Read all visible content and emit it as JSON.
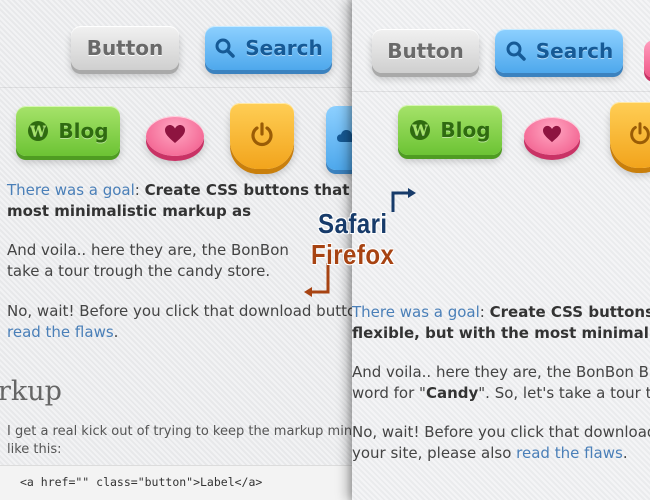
{
  "labels": {
    "safari": "Safari",
    "firefox": "Firefox"
  },
  "colors": {
    "safari_label": "#173b6a",
    "firefox_label": "#a74312",
    "link": "#4a7fb8"
  },
  "firefox_panel": {
    "buttons": {
      "button_label": "Button",
      "search_label": "Search",
      "blog_label": "Blog",
      "heart_icon": "heart-icon",
      "power_icon": "power-icon",
      "search_icon": "search-icon",
      "wordpress_icon": "wordpress-icon"
    },
    "p1": {
      "link": "There was a goal",
      "colon": ": ",
      "bold1": "Create CSS buttons that a",
      "bold2": "most minimalistic markup as"
    },
    "p2": {
      "line1": "And voila.. here they are, the BonBon",
      "line2": "take a tour trough the candy store."
    },
    "p3": {
      "line1": "No, wait! Before you click that download butto",
      "link": "read the flaws",
      "end": "."
    },
    "heading": "rkup",
    "p4": {
      "line1": "I get a real kick out of trying to keep the markup minima",
      "line2": "like this:"
    },
    "code": "<a href=\"\" class=\"button\">Label</a>"
  },
  "safari_panel": {
    "buttons": {
      "button_label": "Button",
      "search_label": "Search",
      "blog_label": "Blog"
    },
    "p1": {
      "link": "There was a goal",
      "colon": ": ",
      "bold1": "Create CSS buttons",
      "bold2": "flexible, but with the most minimali"
    },
    "p2": {
      "line1": "And voila.. here they are, the BonBon Bu",
      "line2a": "word for \"",
      "line2b": "Candy",
      "line2c": "\". So, let's take a tour tr"
    },
    "p3": {
      "line1": "No, wait! Before you click that download",
      "line2a": "your site, please also ",
      "link": "read the flaws",
      "end": "."
    }
  }
}
